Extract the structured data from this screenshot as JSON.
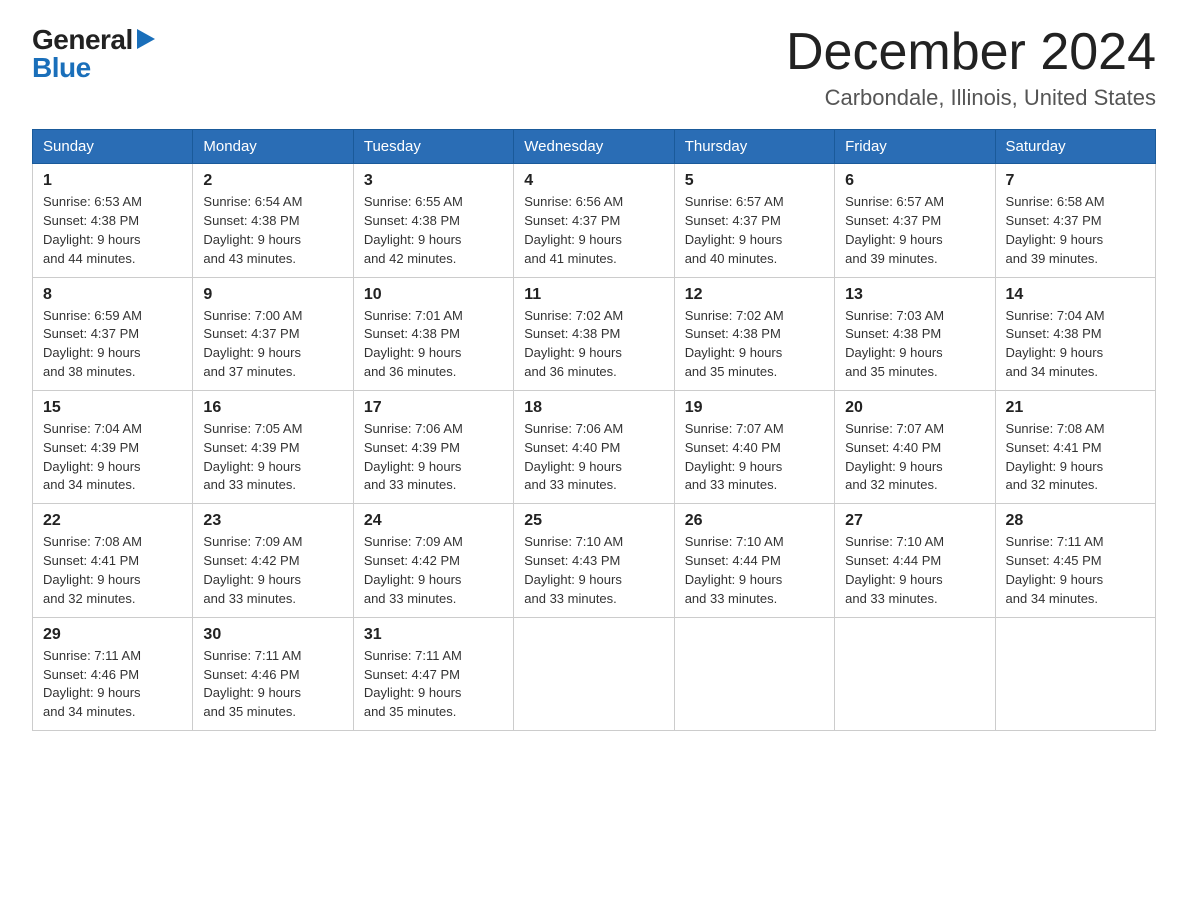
{
  "logo": {
    "general": "General",
    "blue": "Blue",
    "triangle": "▶"
  },
  "title": "December 2024",
  "location": "Carbondale, Illinois, United States",
  "days_header": [
    "Sunday",
    "Monday",
    "Tuesday",
    "Wednesday",
    "Thursday",
    "Friday",
    "Saturday"
  ],
  "weeks": [
    [
      {
        "day": "1",
        "sunrise": "6:53 AM",
        "sunset": "4:38 PM",
        "daylight": "9 hours and 44 minutes."
      },
      {
        "day": "2",
        "sunrise": "6:54 AM",
        "sunset": "4:38 PM",
        "daylight": "9 hours and 43 minutes."
      },
      {
        "day": "3",
        "sunrise": "6:55 AM",
        "sunset": "4:38 PM",
        "daylight": "9 hours and 42 minutes."
      },
      {
        "day": "4",
        "sunrise": "6:56 AM",
        "sunset": "4:37 PM",
        "daylight": "9 hours and 41 minutes."
      },
      {
        "day": "5",
        "sunrise": "6:57 AM",
        "sunset": "4:37 PM",
        "daylight": "9 hours and 40 minutes."
      },
      {
        "day": "6",
        "sunrise": "6:57 AM",
        "sunset": "4:37 PM",
        "daylight": "9 hours and 39 minutes."
      },
      {
        "day": "7",
        "sunrise": "6:58 AM",
        "sunset": "4:37 PM",
        "daylight": "9 hours and 39 minutes."
      }
    ],
    [
      {
        "day": "8",
        "sunrise": "6:59 AM",
        "sunset": "4:37 PM",
        "daylight": "9 hours and 38 minutes."
      },
      {
        "day": "9",
        "sunrise": "7:00 AM",
        "sunset": "4:37 PM",
        "daylight": "9 hours and 37 minutes."
      },
      {
        "day": "10",
        "sunrise": "7:01 AM",
        "sunset": "4:38 PM",
        "daylight": "9 hours and 36 minutes."
      },
      {
        "day": "11",
        "sunrise": "7:02 AM",
        "sunset": "4:38 PM",
        "daylight": "9 hours and 36 minutes."
      },
      {
        "day": "12",
        "sunrise": "7:02 AM",
        "sunset": "4:38 PM",
        "daylight": "9 hours and 35 minutes."
      },
      {
        "day": "13",
        "sunrise": "7:03 AM",
        "sunset": "4:38 PM",
        "daylight": "9 hours and 35 minutes."
      },
      {
        "day": "14",
        "sunrise": "7:04 AM",
        "sunset": "4:38 PM",
        "daylight": "9 hours and 34 minutes."
      }
    ],
    [
      {
        "day": "15",
        "sunrise": "7:04 AM",
        "sunset": "4:39 PM",
        "daylight": "9 hours and 34 minutes."
      },
      {
        "day": "16",
        "sunrise": "7:05 AM",
        "sunset": "4:39 PM",
        "daylight": "9 hours and 33 minutes."
      },
      {
        "day": "17",
        "sunrise": "7:06 AM",
        "sunset": "4:39 PM",
        "daylight": "9 hours and 33 minutes."
      },
      {
        "day": "18",
        "sunrise": "7:06 AM",
        "sunset": "4:40 PM",
        "daylight": "9 hours and 33 minutes."
      },
      {
        "day": "19",
        "sunrise": "7:07 AM",
        "sunset": "4:40 PM",
        "daylight": "9 hours and 33 minutes."
      },
      {
        "day": "20",
        "sunrise": "7:07 AM",
        "sunset": "4:40 PM",
        "daylight": "9 hours and 32 minutes."
      },
      {
        "day": "21",
        "sunrise": "7:08 AM",
        "sunset": "4:41 PM",
        "daylight": "9 hours and 32 minutes."
      }
    ],
    [
      {
        "day": "22",
        "sunrise": "7:08 AM",
        "sunset": "4:41 PM",
        "daylight": "9 hours and 32 minutes."
      },
      {
        "day": "23",
        "sunrise": "7:09 AM",
        "sunset": "4:42 PM",
        "daylight": "9 hours and 33 minutes."
      },
      {
        "day": "24",
        "sunrise": "7:09 AM",
        "sunset": "4:42 PM",
        "daylight": "9 hours and 33 minutes."
      },
      {
        "day": "25",
        "sunrise": "7:10 AM",
        "sunset": "4:43 PM",
        "daylight": "9 hours and 33 minutes."
      },
      {
        "day": "26",
        "sunrise": "7:10 AM",
        "sunset": "4:44 PM",
        "daylight": "9 hours and 33 minutes."
      },
      {
        "day": "27",
        "sunrise": "7:10 AM",
        "sunset": "4:44 PM",
        "daylight": "9 hours and 33 minutes."
      },
      {
        "day": "28",
        "sunrise": "7:11 AM",
        "sunset": "4:45 PM",
        "daylight": "9 hours and 34 minutes."
      }
    ],
    [
      {
        "day": "29",
        "sunrise": "7:11 AM",
        "sunset": "4:46 PM",
        "daylight": "9 hours and 34 minutes."
      },
      {
        "day": "30",
        "sunrise": "7:11 AM",
        "sunset": "4:46 PM",
        "daylight": "9 hours and 35 minutes."
      },
      {
        "day": "31",
        "sunrise": "7:11 AM",
        "sunset": "4:47 PM",
        "daylight": "9 hours and 35 minutes."
      },
      null,
      null,
      null,
      null
    ]
  ],
  "labels": {
    "sunrise": "Sunrise: ",
    "sunset": "Sunset: ",
    "daylight": "Daylight: "
  }
}
